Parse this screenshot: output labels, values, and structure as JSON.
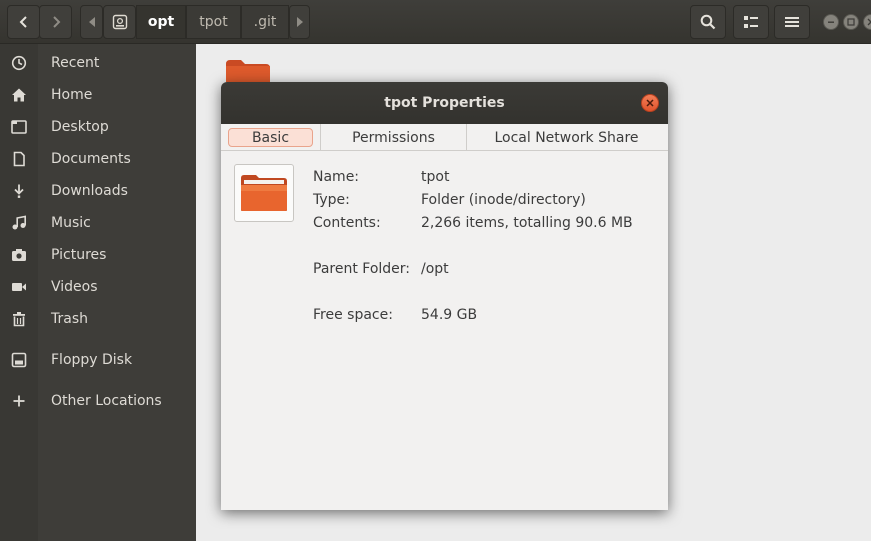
{
  "window": {
    "path": [
      "opt",
      "tpot",
      ".git"
    ]
  },
  "sidebar": {
    "items": [
      {
        "label": "Recent",
        "icon": "clock-icon"
      },
      {
        "label": "Home",
        "icon": "home-icon"
      },
      {
        "label": "Desktop",
        "icon": "desktop-folder-icon"
      },
      {
        "label": "Documents",
        "icon": "document-icon"
      },
      {
        "label": "Downloads",
        "icon": "download-icon"
      },
      {
        "label": "Music",
        "icon": "music-icon"
      },
      {
        "label": "Pictures",
        "icon": "camera-icon"
      },
      {
        "label": "Videos",
        "icon": "video-icon"
      },
      {
        "label": "Trash",
        "icon": "trash-icon"
      },
      {
        "label": "Floppy Disk",
        "icon": "floppy-icon"
      },
      {
        "label": "Other Locations",
        "icon": "plus-icon"
      }
    ]
  },
  "dialog": {
    "title": "tpot Properties",
    "tabs": [
      "Basic",
      "Permissions",
      "Local Network Share"
    ],
    "selected_tab": "Basic",
    "props": [
      {
        "key": "Name:",
        "value": "tpot"
      },
      {
        "key": "Type:",
        "value": "Folder (inode/directory)"
      },
      {
        "key": "Contents:",
        "value": "2,266 items, totalling 90.6 MB"
      },
      {
        "key": "Parent Folder:",
        "value": "/opt"
      },
      {
        "key": "Free space:",
        "value": "54.9 GB"
      }
    ]
  },
  "colors": {
    "accent": "#e95420",
    "header_bg": "#3b3a36",
    "sidebar_bg": "#3e3d39"
  }
}
